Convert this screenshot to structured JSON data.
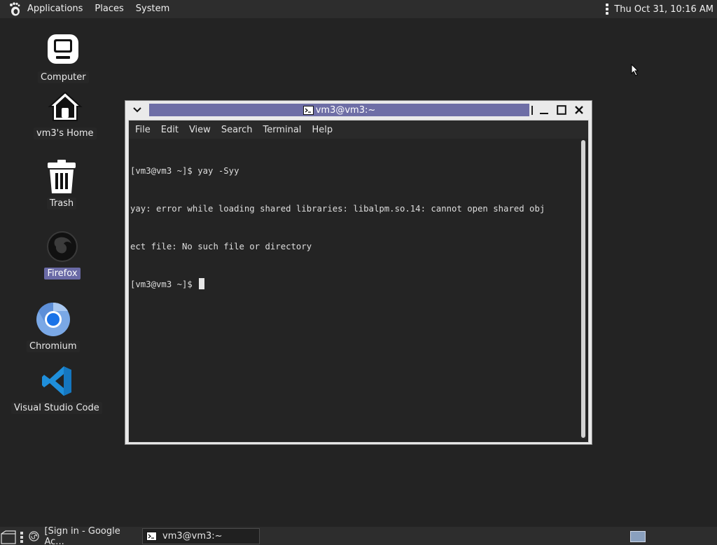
{
  "top_panel": {
    "menus": [
      "Applications",
      "Places",
      "System"
    ],
    "clock": "Thu Oct 31, 10:16 AM",
    "icons": {
      "logo": "gnome-foot-icon",
      "overflow": "vertical-dots-icon"
    }
  },
  "desktop": {
    "icons": [
      {
        "label": "Computer",
        "icon": "computer-icon"
      },
      {
        "label": "vm3's Home",
        "icon": "home-icon"
      },
      {
        "label": "Trash",
        "icon": "trash-icon"
      },
      {
        "label": "Firefox",
        "icon": "firefox-icon",
        "selected": true
      },
      {
        "label": "Chromium",
        "icon": "chromium-icon"
      },
      {
        "label": "Visual Studio Code",
        "icon": "vscode-icon"
      }
    ]
  },
  "terminal": {
    "title": "vm3@vm3:~",
    "menu": [
      "File",
      "Edit",
      "View",
      "Search",
      "Terminal",
      "Help"
    ],
    "lines": [
      "[vm3@vm3 ~]$ yay -Syy",
      "yay: error while loading shared libraries: libalpm.so.14: cannot open shared obj",
      "ect file: No such file or directory",
      "[vm3@vm3 ~]$ "
    ]
  },
  "taskbar": {
    "tasks": [
      {
        "label": "[Sign in - Google Ac...",
        "icon": "firefox-icon"
      },
      {
        "label": "vm3@vm3:~",
        "icon": "terminal-icon",
        "active": true
      }
    ]
  },
  "colors": {
    "desktop_bg": "#232323",
    "panel_bg": "#2d2d2d",
    "title_accent": "#6e6ea6",
    "terminal_bg": "#242424"
  }
}
